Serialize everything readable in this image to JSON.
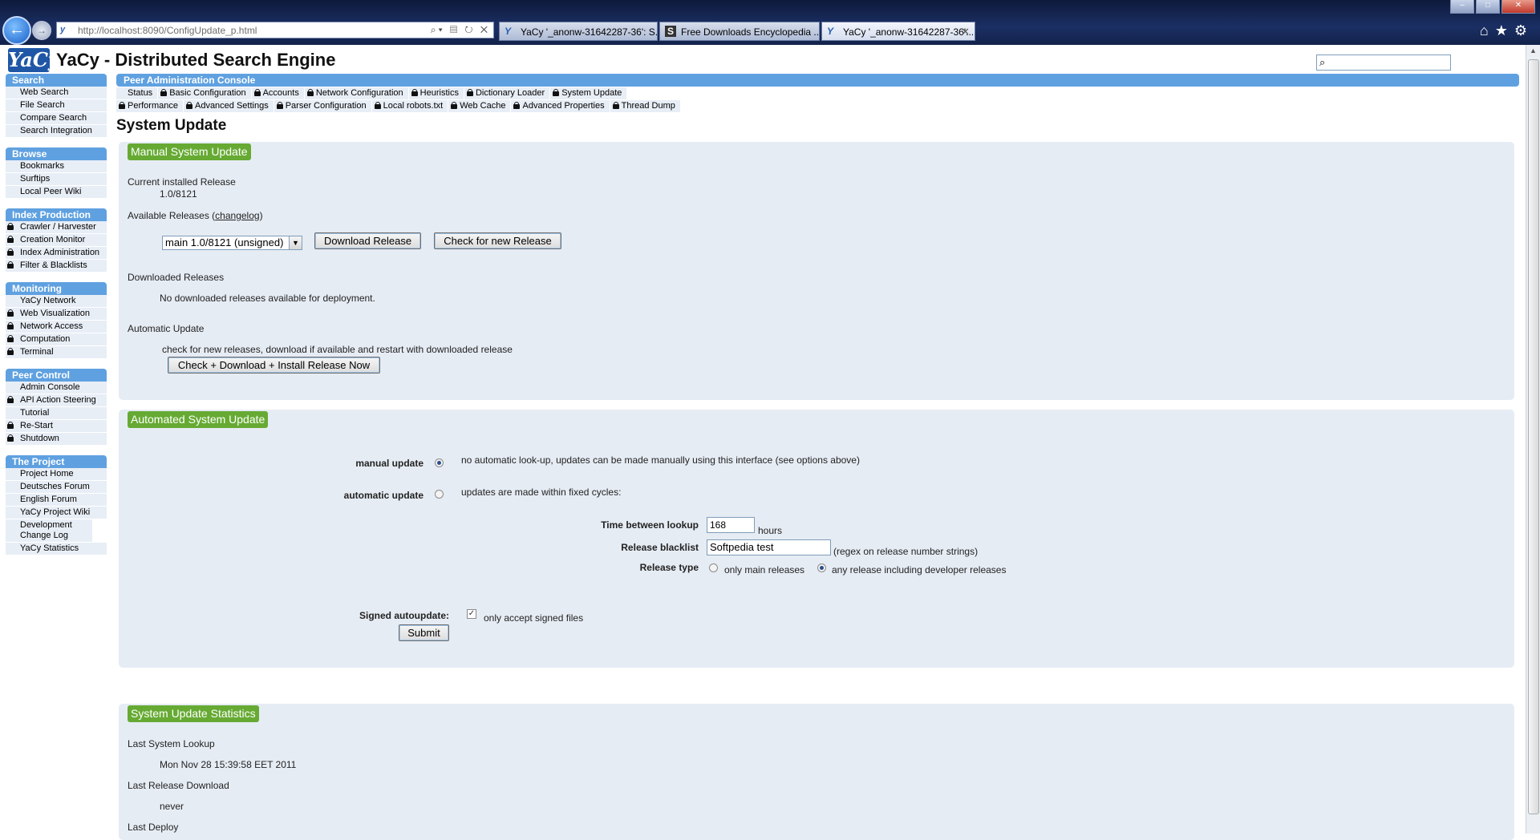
{
  "browser": {
    "url": "http://localhost:8090/ConfigUpdate_p.html",
    "tabs": [
      {
        "label": "YaCy '_anonw-31642287-36': S...",
        "icon": "Y"
      },
      {
        "label": "Free Downloads Encyclopedia ...",
        "icon": "S"
      },
      {
        "label": "YaCy '_anonw-31642287-36'...",
        "icon": "Y"
      }
    ]
  },
  "site": {
    "logo": "YaCy",
    "title": "YaCy - Distributed Search Engine"
  },
  "sidebar": {
    "search": {
      "title": "Search",
      "items": [
        "Web Search",
        "File Search",
        "Compare Search",
        "Search Integration"
      ]
    },
    "browse": {
      "title": "Browse",
      "items": [
        "Bookmarks",
        "Surftips",
        "Local Peer Wiki"
      ]
    },
    "index": {
      "title": "Index Production",
      "items": [
        "Crawler / Harvester",
        "Creation Monitor",
        "Index Administration",
        "Filter & Blacklists"
      ]
    },
    "monitoring": {
      "title": "Monitoring",
      "items": [
        "YaCy Network",
        "Web Visualization",
        "Network Access",
        "Computation",
        "Terminal"
      ]
    },
    "peer": {
      "title": "Peer Control",
      "items": [
        "Admin Console",
        "API Action Steering",
        "Tutorial",
        "Re-Start",
        "Shutdown"
      ]
    },
    "project": {
      "title": "The Project",
      "items": [
        "Project Home",
        "Deutsches Forum",
        "English Forum",
        "YaCy Project Wiki",
        "Development Change Log",
        "YaCy Statistics"
      ]
    }
  },
  "console": {
    "title": "Peer Administration Console",
    "row1": [
      "Status",
      "Basic Configuration",
      "Accounts",
      "Network Configuration",
      "Heuristics",
      "Dictionary Loader",
      "System Update"
    ],
    "row2": [
      "Performance",
      "Advanced Settings",
      "Parser Configuration",
      "Local robots.txt",
      "Web Cache",
      "Advanced Properties",
      "Thread Dump"
    ]
  },
  "page": {
    "heading": "System Update"
  },
  "manual": {
    "legend": "Manual System Update",
    "current_label": "Current installed Release",
    "current_value": "1.0/8121",
    "available_label": "Available Releases (",
    "changelog": "changelog",
    "available_close": ")",
    "release_select": "main 1.0/8121 (unsigned)",
    "download_btn": "Download Release",
    "check_btn": "Check for new Release",
    "downloaded_label": "Downloaded Releases",
    "downloaded_value": "No downloaded releases available for deployment.",
    "auto_label": "Automatic Update",
    "auto_desc": "check for new releases, download if available and restart with downloaded release",
    "install_btn": "Check + Download + Install Release Now"
  },
  "automated": {
    "legend": "Automated System Update",
    "manual_label": "manual update",
    "manual_desc": "no automatic look-up, updates can be made manually using this interface (see options above)",
    "auto_label": "automatic update",
    "auto_desc": "updates are made within fixed cycles:",
    "time_label": "Time between lookup",
    "time_value": "168",
    "time_unit": "hours",
    "blacklist_label": "Release blacklist",
    "blacklist_value": "Softpedia test",
    "blacklist_hint": "(regex on release number strings)",
    "type_label": "Release type",
    "type_main": "only main releases",
    "type_any": "any release including developer releases",
    "signed_label": "Signed autoupdate:",
    "signed_desc": "only accept signed files",
    "submit": "Submit"
  },
  "stats": {
    "legend": "System Update Statistics",
    "lookup_label": "Last System Lookup",
    "lookup_value": "Mon Nov 28 15:39:58 EET 2011",
    "download_label": "Last Release Download",
    "download_value": "never",
    "deploy_label": "Last Deploy"
  }
}
